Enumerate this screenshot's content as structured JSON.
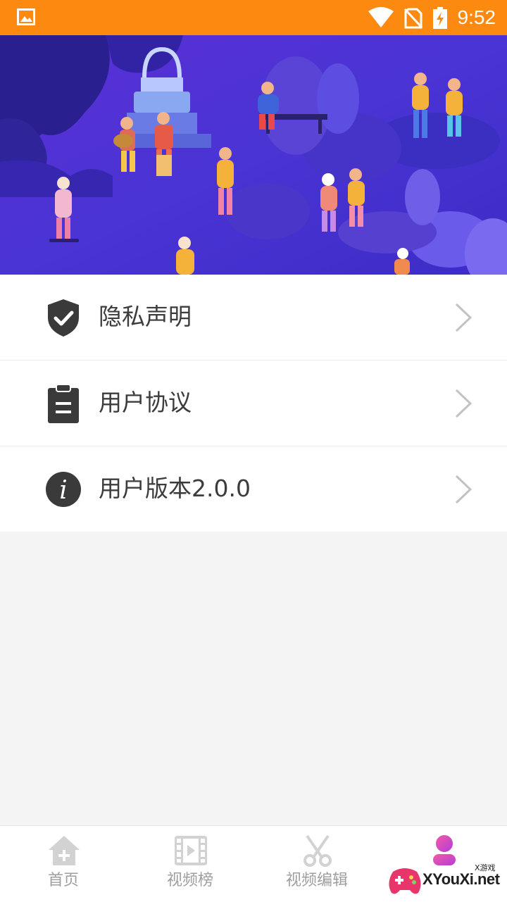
{
  "status_bar": {
    "time": "9:52",
    "icons": [
      "image-icon",
      "wifi-icon",
      "no-sim-icon",
      "battery-charging-icon"
    ]
  },
  "banner": {
    "illustration": "park-party-illustration"
  },
  "menu": {
    "items": [
      {
        "icon": "shield-check-icon",
        "label": "隐私声明"
      },
      {
        "icon": "clipboard-icon",
        "label": "用户协议"
      },
      {
        "icon": "info-icon",
        "label": "用户版本2.0.0"
      }
    ]
  },
  "bottom_nav": {
    "tabs": [
      {
        "icon": "home-icon",
        "label": "首页"
      },
      {
        "icon": "film-icon",
        "label": "视频榜"
      },
      {
        "icon": "scissors-icon",
        "label": "视频编辑"
      },
      {
        "icon": "user-icon",
        "label": ""
      }
    ],
    "active_index": 3
  },
  "watermark": {
    "text": "XYouXi.net",
    "small": "X游戏"
  },
  "colors": {
    "status_bar": "#fd8a10",
    "banner_bg": "#4b2fd4",
    "icon_dark": "#3a3a3a",
    "active_accent": "#e05aa0",
    "inactive_nav": "#cfcfcf"
  }
}
